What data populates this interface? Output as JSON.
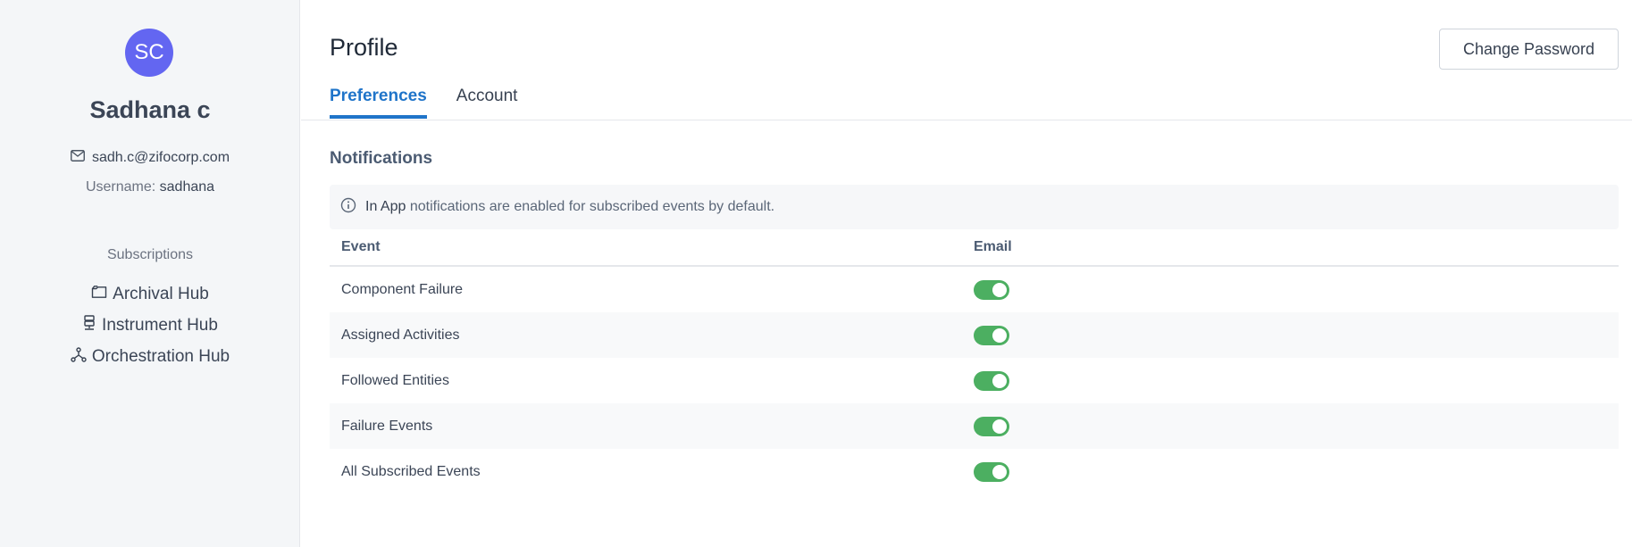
{
  "sidebar": {
    "avatar_initials": "SC",
    "avatar_color": "#6366f1",
    "name": "Sadhana c",
    "email": "sadh.c@zifocorp.com",
    "username_label": "Username:",
    "username": "sadhana",
    "subscriptions_title": "Subscriptions",
    "subscriptions": [
      {
        "label": "Archival Hub",
        "icon": "folder-icon"
      },
      {
        "label": "Instrument Hub",
        "icon": "instrument-icon"
      },
      {
        "label": "Orchestration Hub",
        "icon": "network-icon"
      }
    ]
  },
  "header": {
    "title": "Profile",
    "change_password_label": "Change Password"
  },
  "tabs": [
    {
      "label": "Preferences",
      "active": true
    },
    {
      "label": "Account",
      "active": false
    }
  ],
  "notifications": {
    "title": "Notifications",
    "info_prefix": "In App",
    "info_text": "notifications are enabled for subscribed events by default.",
    "columns": {
      "event": "Event",
      "email": "Email"
    },
    "rows": [
      {
        "event": "Component Failure",
        "email_enabled": true
      },
      {
        "event": "Assigned Activities",
        "email_enabled": true
      },
      {
        "event": "Followed Entities",
        "email_enabled": true
      },
      {
        "event": "Failure Events",
        "email_enabled": true
      },
      {
        "event": "All Subscribed Events",
        "email_enabled": true
      }
    ]
  },
  "colors": {
    "accent": "#1f74c9",
    "toggle_on": "#4caf61"
  }
}
